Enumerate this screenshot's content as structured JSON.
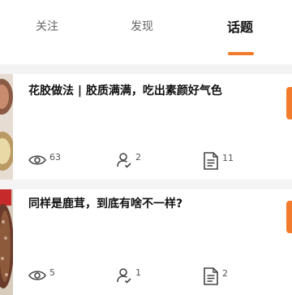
{
  "tabs": [
    {
      "label": "关注",
      "active": false
    },
    {
      "label": "发现",
      "active": false
    },
    {
      "label": "话题",
      "active": true
    }
  ],
  "accent_color": "#f27a2c",
  "topics": [
    {
      "title": "花胶做法 | 胶质满满，吃出素颜好气色",
      "views": "63",
      "participants": "2",
      "posts": "11"
    },
    {
      "title": "同样是鹿茸，到底有啥不一样?",
      "views": "5",
      "participants": "1",
      "posts": "2"
    }
  ]
}
